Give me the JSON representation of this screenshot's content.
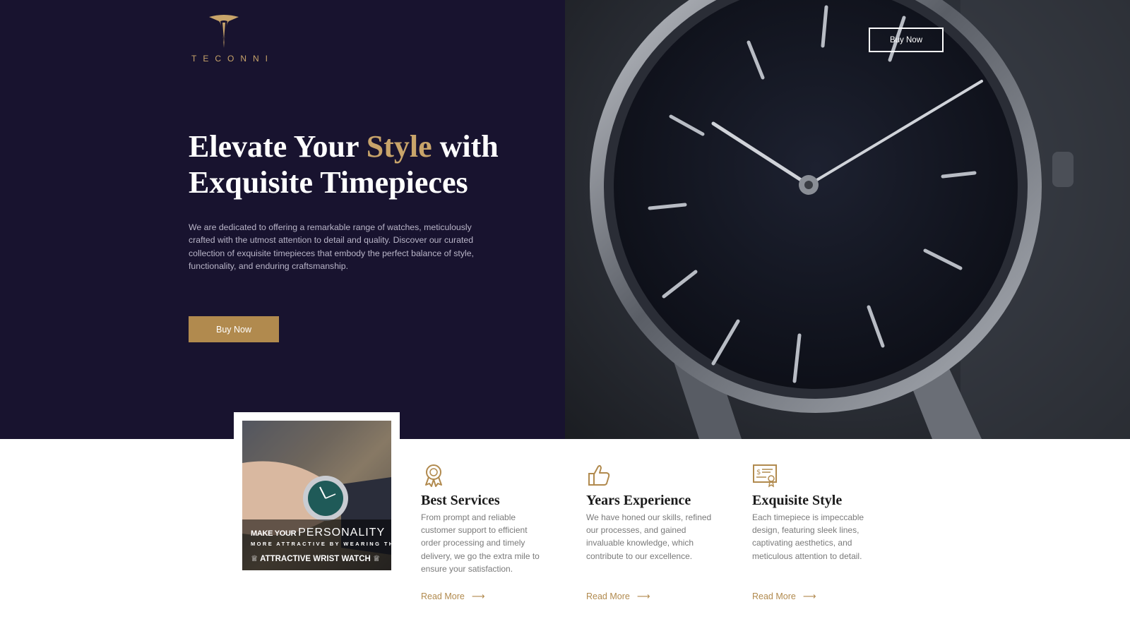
{
  "brand": {
    "name": "TECONNI",
    "gold": "#c8a46a",
    "navy": "#18132f"
  },
  "header": {
    "buy_now_label": "Buy Now"
  },
  "hero": {
    "title_part1": "Elevate Your ",
    "title_accent": "Style",
    "title_part2": " with",
    "title_line2": "Exquisite Timepieces",
    "description": "We are dedicated to offering a remarkable range of watches, meticulously crafted with the utmost attention to detail and quality. Discover our curated collection of exquisite timepieces that embody the perfect balance of style, functionality, and enduring craftsmanship.",
    "cta_label": "Buy Now"
  },
  "promo": {
    "line1_small": "MAKE YOUR",
    "line1_big": "PERSONALITY",
    "line2": "MORE ATTRACTIVE BY WEARING THIS",
    "line3": "ATTRACTIVE WRIST WATCH"
  },
  "features": [
    {
      "icon": "award-icon",
      "title": "Best Services",
      "text": "From prompt and reliable customer support to efficient order processing and timely delivery, we go the extra mile to ensure your satisfaction.",
      "link": "Read More"
    },
    {
      "icon": "thumbs-up-icon",
      "title": "Years Experience",
      "text": "We have honed our skills, refined our processes, and gained invaluable knowledge, which contribute to our excellence.",
      "link": "Read More"
    },
    {
      "icon": "certificate-icon",
      "title": "Exquisite Style",
      "text": "Each timepiece is impeccable design, featuring sleek lines, captivating aesthetics, and meticulous attention to detail.",
      "link": "Read More"
    }
  ]
}
